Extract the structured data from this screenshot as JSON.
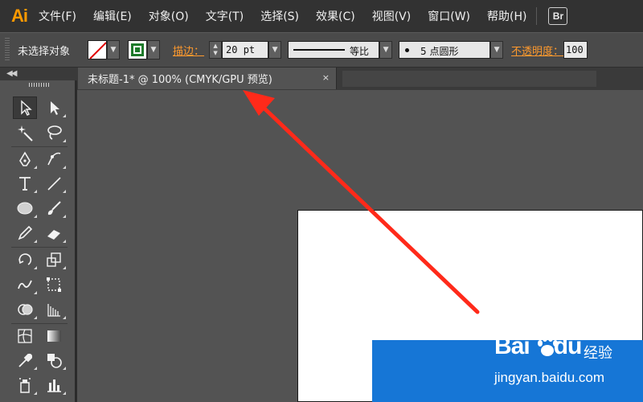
{
  "app": {
    "logo": "Ai",
    "bridge_button": "Br"
  },
  "menu": [
    "文件(F)",
    "编辑(E)",
    "对象(O)",
    "文字(T)",
    "选择(S)",
    "效果(C)",
    "视图(V)",
    "窗口(W)",
    "帮助(H)"
  ],
  "control_bar": {
    "selection_status": "未选择对象",
    "stroke_label": "描边：",
    "stroke_weight": "20 pt",
    "profile_label": "等比",
    "brush_label": "5 点圆形",
    "opacity_label": "不透明度：",
    "opacity_value": "100"
  },
  "document_tab": {
    "title": "未标题-1* @ 100% (CMYK/GPU 预览)",
    "close_glyph": "×"
  },
  "tools": [
    "selection-tool",
    "direct-selection-tool",
    "magic-wand-tool",
    "lasso-tool",
    "pen-tool",
    "curvature-tool",
    "type-tool",
    "line-segment-tool",
    "ellipse-tool",
    "paintbrush-tool",
    "pencil-tool",
    "eraser-tool",
    "rotate-tool",
    "scale-tool",
    "warp-tool",
    "free-transform-tool",
    "shape-builder-tool",
    "perspective-grid-tool",
    "mesh-tool",
    "gradient-tool",
    "eyedropper-tool",
    "blend-tool",
    "symbol-sprayer-tool",
    "column-graph-tool"
  ],
  "watermark": {
    "brand": "Bai",
    "brand2": "du",
    "product": "经验",
    "url": "jingyan.baidu.com"
  },
  "colors": {
    "accent": "#ff9a00",
    "annotation_arrow": "#ff2a1a",
    "blue_shape": "#1676d6",
    "artboard": "#ffffff",
    "workspace": "#535353"
  }
}
